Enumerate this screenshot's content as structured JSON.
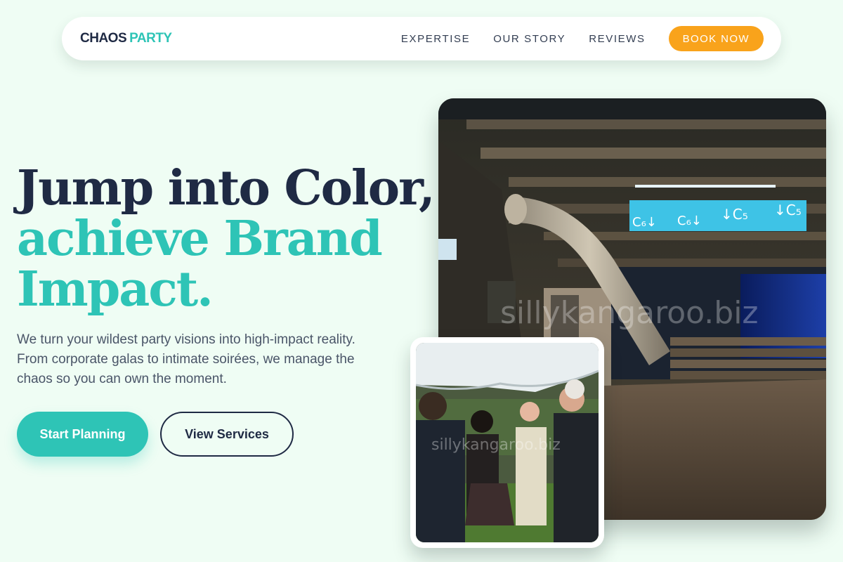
{
  "brand": {
    "part1": "CHAOS",
    "part2": "PARTY"
  },
  "nav": {
    "items": [
      {
        "label": "EXPERTISE"
      },
      {
        "label": "OUR STORY"
      },
      {
        "label": "REVIEWS"
      }
    ],
    "cta_label": "BOOK NOW"
  },
  "hero": {
    "line1": "Jump into Color,",
    "line2": "achieve Brand",
    "line3": "Impact.",
    "description": "We turn your wildest party visions into high-impact reality. From corporate galas to intimate soirées, we manage the chaos so you can own the moment.",
    "primary_label": "Start Planning",
    "secondary_label": "View Services"
  },
  "images": {
    "main": {
      "signs": [
        "C₆↓",
        "C₆↓",
        "↓C₅",
        "↓C₅"
      ],
      "watermark": "sillykangaroo.biz"
    },
    "small": {
      "watermark": "sillykangaroo.biz"
    }
  },
  "colors": {
    "background": "#effdf4",
    "navy": "#1f2a44",
    "teal": "#2ec4b6",
    "orange": "#f9a31b"
  }
}
